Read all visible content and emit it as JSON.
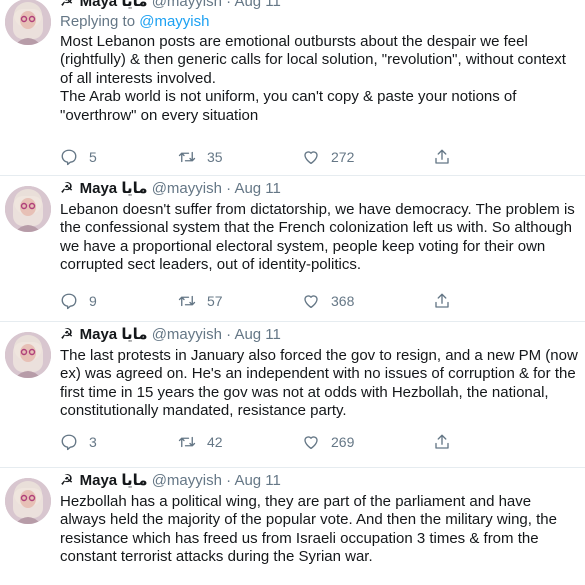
{
  "tweets": [
    {
      "symbol": "☭",
      "name": "Maya",
      "arabic_name": "مايا",
      "handle": "@mayyish",
      "date": "Aug 11",
      "replying_label": "Replying to",
      "replying_to": "@mayyish",
      "text": "Most Lebanon posts are emotional outbursts about the despair we feel (rightfully) & then generic calls for local solution, \"revolution\", without context of all interests involved.\nThe Arab world is not uniform, you can't copy & paste your notions of \"overthrow\" on every situation",
      "replies": "5",
      "retweets": "35",
      "likes": "272"
    },
    {
      "symbol": "☭",
      "name": "Maya",
      "arabic_name": "مايا",
      "handle": "@mayyish",
      "date": "Aug 11",
      "text": "Lebanon doesn't suffer from dictatorship, we have democracy. The problem is the confessional system that the French colonization left us with. So although we have a proportional electoral system, people keep voting for their own corrupted sect leaders, out of identity-politics.",
      "replies": "9",
      "retweets": "57",
      "likes": "368"
    },
    {
      "symbol": "☭",
      "name": "Maya",
      "arabic_name": "مايا",
      "handle": "@mayyish",
      "date": "Aug 11",
      "text": "The last protests in January also forced the gov to resign, and a new PM (now ex) was agreed on. He's an independent with no issues of corruption & for the first time in 15 years the gov was not at odds with Hezbollah, the national, constitutionally mandated, resistance party.",
      "replies": "3",
      "retweets": "42",
      "likes": "269"
    },
    {
      "symbol": "☭",
      "name": "Maya",
      "arabic_name": "مايا",
      "handle": "@mayyish",
      "date": "Aug 11",
      "text": "Hezbollah has a political wing, they are part of the parliament and have always held the majority of the popular vote. And then the military wing, the resistance which has freed us from Israeli occupation 3 times & from the constant terrorist attacks during the Syrian war."
    }
  ],
  "separator": "·",
  "icons": [
    "reply-icon",
    "retweet-icon",
    "like-icon",
    "share-icon"
  ],
  "colors": {
    "link": "#1da1f2",
    "muted": "#657786",
    "text": "#14171a",
    "divider": "#e6ecf0"
  }
}
